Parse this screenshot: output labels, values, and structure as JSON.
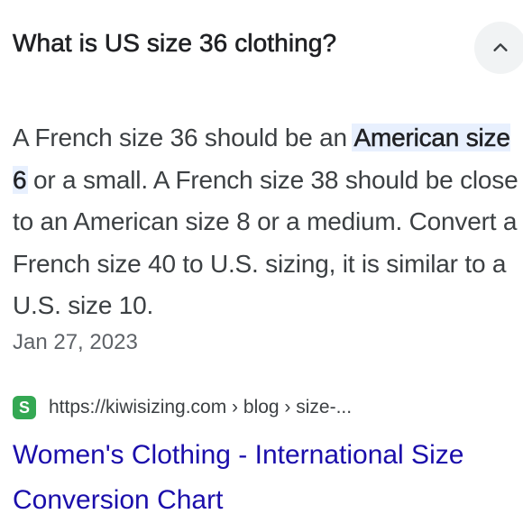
{
  "question": {
    "title": "What is US size 36 clothing?",
    "toggle_icon": "chevron-up-icon"
  },
  "answer": {
    "text_before": "A French size 36 should be an ",
    "highlight": "American size 6",
    "text_after": " or a small. A French size 38 should be close to an American size 8 or a medium. Convert a French size 40 to U.S. sizing, it is similar to a U.S. size 10.",
    "date": "Jan 27, 2023"
  },
  "source": {
    "favicon_letter": "S",
    "favicon_color": "#34a853",
    "url": "https://kiwisizing.com › blog › size-..."
  },
  "result": {
    "title": "Women's Clothing - International Size Conversion Chart",
    "link_color": "#1a0dab"
  },
  "colors": {
    "highlight_bg": "#e8f0fe",
    "button_bg": "#f1f3f4"
  }
}
